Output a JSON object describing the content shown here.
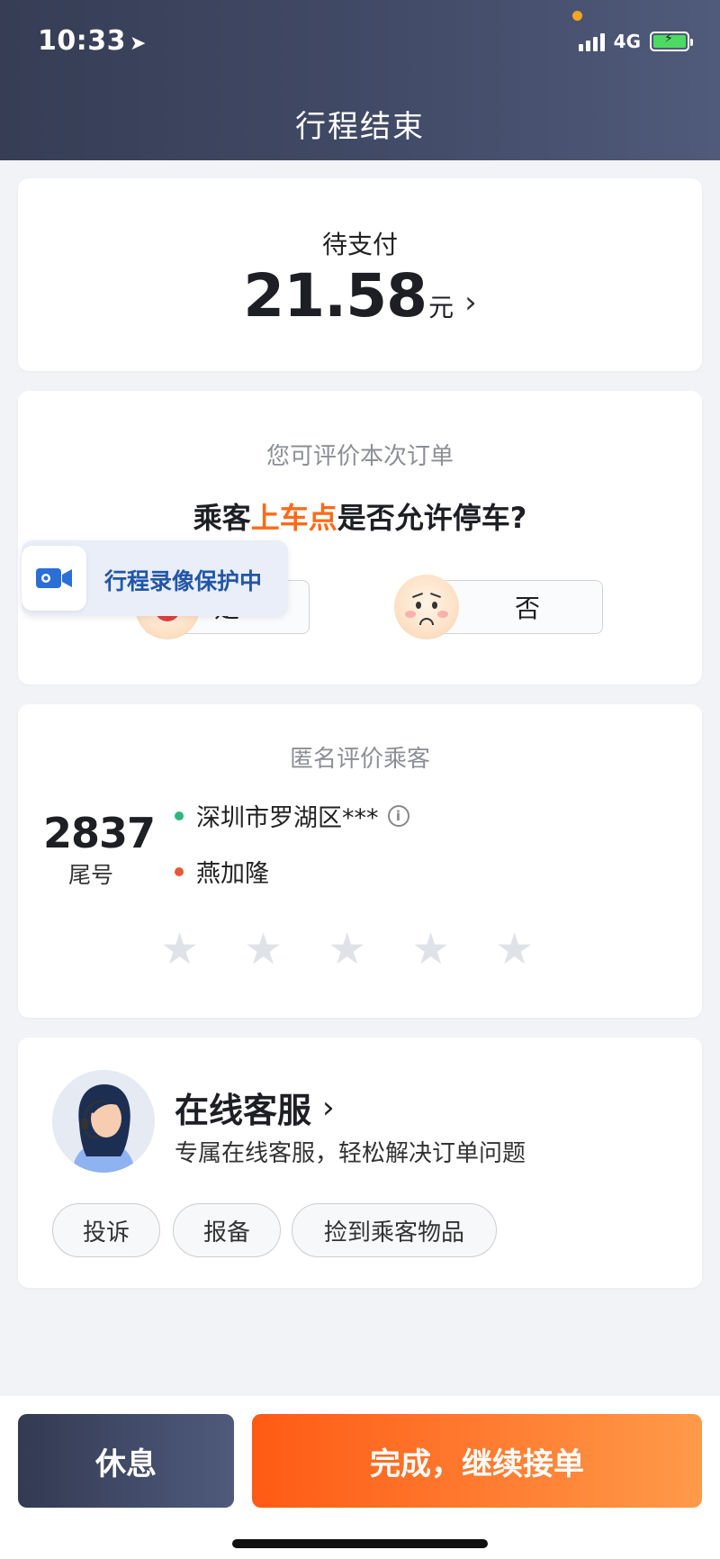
{
  "status_bar": {
    "time": "10:33",
    "location_icon": "location-arrow-icon",
    "network": "4G",
    "signal_icon": "signal-bars-icon",
    "battery_icon": "battery-charging-icon"
  },
  "header": {
    "title": "行程结束"
  },
  "payment": {
    "label": "待支付",
    "amount": "21.58",
    "unit": "元",
    "chevron": "›"
  },
  "evaluate": {
    "subtitle": "您可评价本次订单",
    "question_prefix": "乘客",
    "question_highlight": "上车点",
    "question_suffix": "是否允许停车?",
    "yes_label": "是",
    "no_label": "否",
    "highlight_color": "#ff6a1a"
  },
  "record_badge": {
    "text": "行程录像保护中",
    "icon": "video-camera-icon"
  },
  "rate_passenger": {
    "title": "匿名评价乘客",
    "tail_number": "2837",
    "tail_label": "尾号",
    "start_location": "深圳市罗湖区***",
    "end_location": "燕加隆",
    "start_dot_color": "#2db77e",
    "end_dot_color": "#e8573a",
    "stars": 5,
    "rating": 0
  },
  "service": {
    "title": "在线客服",
    "subtitle": "专属在线客服，轻松解决订单问题",
    "buttons": [
      "投诉",
      "报备",
      "捡到乘客物品"
    ]
  },
  "bottom": {
    "rest_label": "休息",
    "done_label": "完成，继续接单"
  }
}
